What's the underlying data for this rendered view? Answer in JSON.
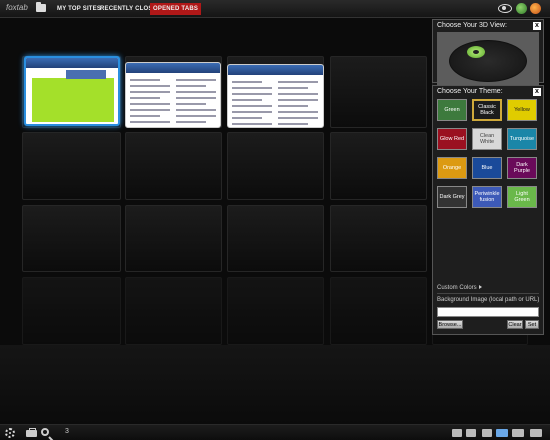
{
  "topbar": {
    "logo": "foxtab",
    "tabs": [
      {
        "label": "MY TOP SITES",
        "active": false
      },
      {
        "label": "RECENTLY CLOSED",
        "active": false
      },
      {
        "label": "OPENED TABS",
        "active": true
      }
    ],
    "accent": "#b01818",
    "icons": [
      "folder-icon",
      "eye-icon",
      "foxtab-icon",
      "globe-icon"
    ]
  },
  "view_panel": {
    "title": "Choose Your 3D View:",
    "close": "x"
  },
  "theme_panel": {
    "title": "Choose Your Theme:",
    "close": "x",
    "themes": [
      {
        "label": "Green",
        "color": "#3d7a3d",
        "selected": false
      },
      {
        "label": "Classic Black",
        "color": "#1c1c1c",
        "selected": true
      },
      {
        "label": "Yellow",
        "color": "#e0cc00",
        "selected": false
      },
      {
        "label": "Glow Red",
        "color": "#9a1020",
        "selected": false
      },
      {
        "label": "Clean White",
        "color": "#d8d8d8",
        "selected": false
      },
      {
        "label": "Turquoise",
        "color": "#1a86a8",
        "selected": false
      },
      {
        "label": "Orange",
        "color": "#dc9a12",
        "selected": false
      },
      {
        "label": "Blue",
        "color": "#1a4a9a",
        "selected": false
      },
      {
        "label": "Dark Purple",
        "color": "#6a0a5a",
        "selected": false
      },
      {
        "label": "Dark Grey",
        "color": "#333333",
        "selected": false
      },
      {
        "label": "Periwinkle fusion",
        "color": "#3d5ab8",
        "selected": false
      },
      {
        "label": "Light Green",
        "color": "#6ab84a",
        "selected": false
      }
    ],
    "custom_colors_label": "Custom Colors",
    "bg_label": "Background Image (local path or URL)",
    "bg_value": "",
    "browse_label": "Browse...",
    "clear_label": "Clear",
    "set_label": "Set"
  },
  "bottombar": {
    "page_count": "3",
    "icons": [
      "gear-icon",
      "briefcase-icon",
      "search-icon"
    ],
    "view_icons": [
      "view-icon-1",
      "view-icon-2",
      "view-icon-3",
      "view-icon-4",
      "view-icon-5",
      "view-icon-6"
    ],
    "active_view_color": "#6aa8e8"
  },
  "thumbnails": [
    {
      "name": "thumb-site-1",
      "selected": true,
      "accent": "#a4e02a"
    },
    {
      "name": "thumb-site-2",
      "selected": false,
      "accent": "#3b6db4"
    },
    {
      "name": "thumb-site-3",
      "selected": false,
      "accent": "#3b6db4"
    }
  ]
}
